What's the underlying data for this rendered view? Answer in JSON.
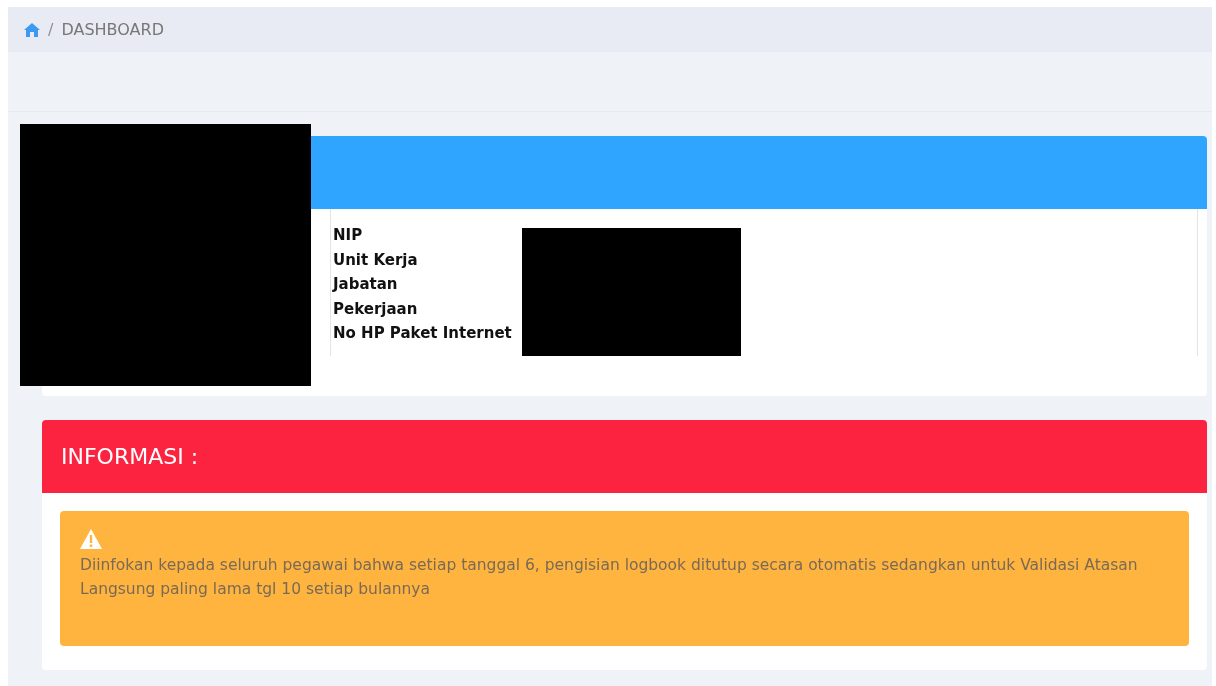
{
  "breadcrumb": {
    "separator": "/",
    "items": [
      {
        "label": "DASHBOARD"
      }
    ]
  },
  "profile": {
    "fields": [
      {
        "label": "NIP"
      },
      {
        "label": "Unit Kerja"
      },
      {
        "label": "Jabatan"
      },
      {
        "label": "Pekerjaan"
      },
      {
        "label": "No HP Paket Internet"
      }
    ]
  },
  "info": {
    "title": "INFORMASI :",
    "alert": {
      "text": "Diinfokan kepada seluruh pegawai bahwa setiap tanggal 6, pengisian logbook ditutup secara otomatis sedangkan untuk Validasi Atasan Langsung paling lama tgl 10 setiap bulannya"
    }
  }
}
